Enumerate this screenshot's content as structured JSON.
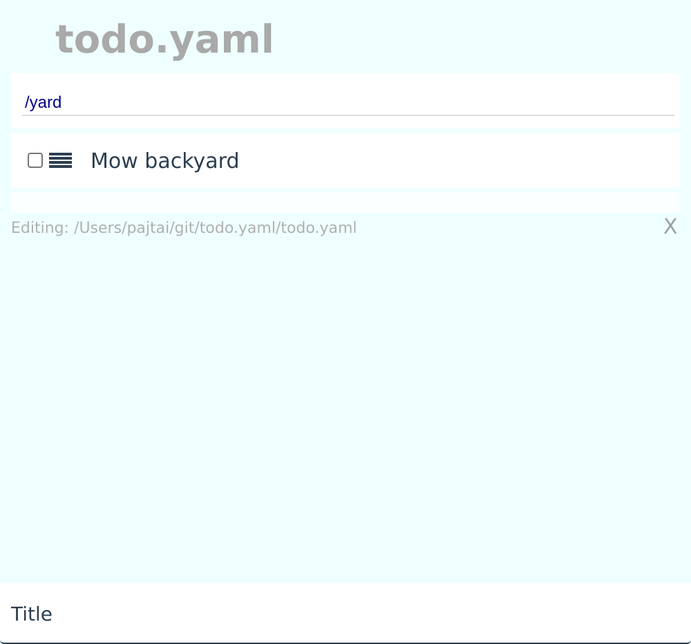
{
  "app": {
    "title": "todo.yaml"
  },
  "filter": {
    "value": "/yard"
  },
  "todos": [
    {
      "title": "Mow backyard",
      "done": false,
      "icon": "list-icon"
    }
  ],
  "status": {
    "editing_text": "Editing: /Users/pajtai/git/todo.yaml/todo.yaml",
    "close_label": "X"
  },
  "new_item": {
    "placeholder": "Title"
  },
  "colors": {
    "background": "#efffff",
    "panel": "#ffffff",
    "title_gray": "#a9a9a9",
    "text_dark": "#2c3e50",
    "filter_text": "#00008b",
    "muted": "#b0b0b0"
  }
}
